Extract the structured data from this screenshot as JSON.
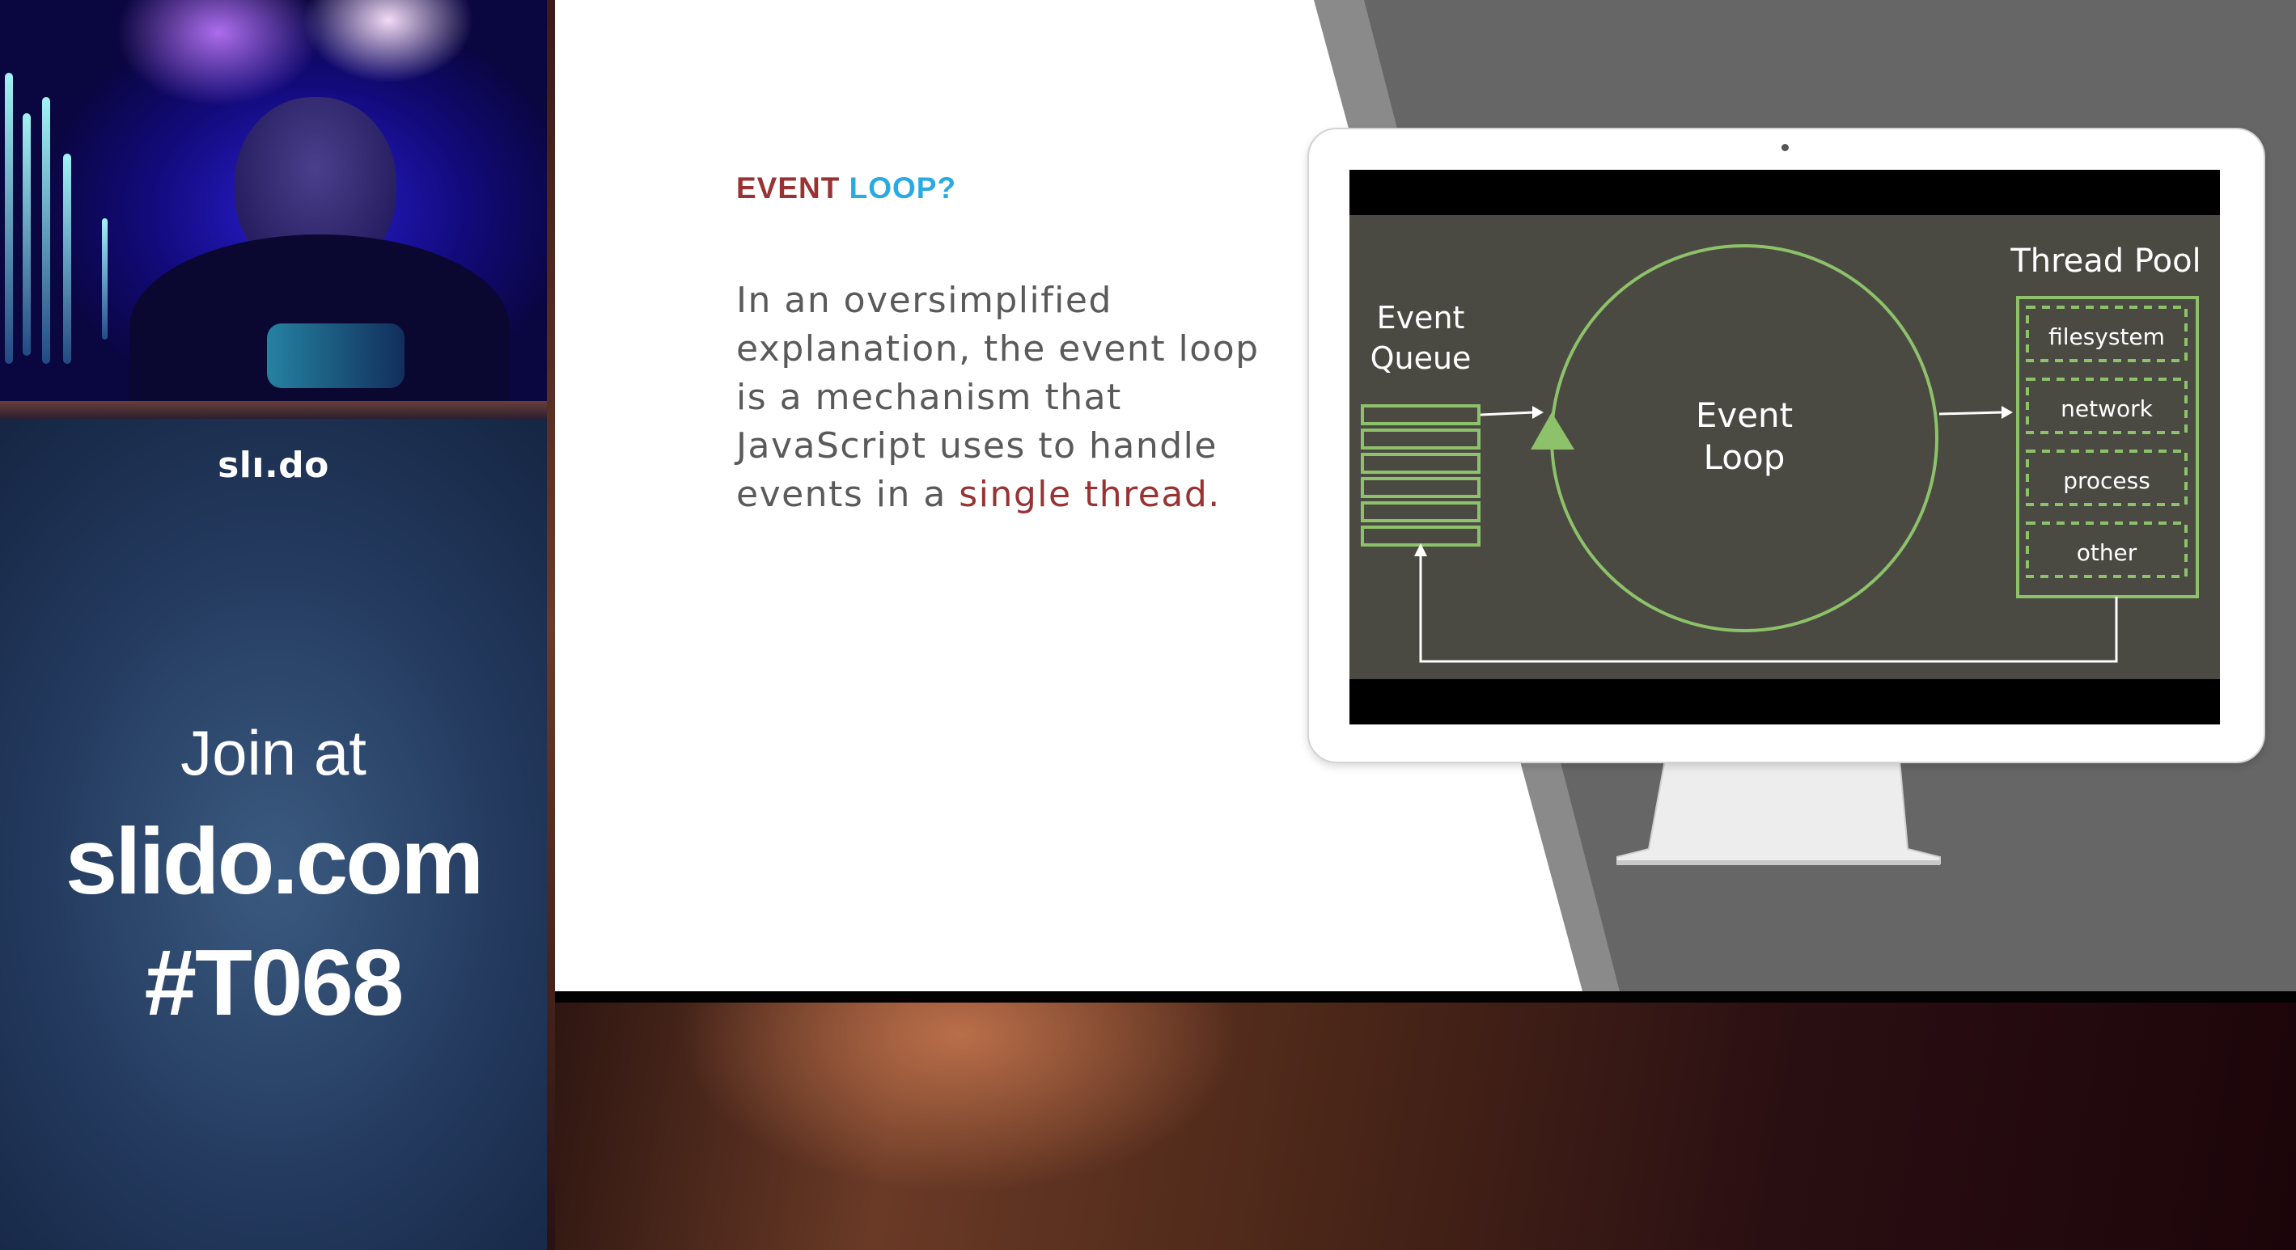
{
  "sidebar": {
    "logo_text": "slı.do",
    "join_text": "Join at",
    "url_text": "slido.com",
    "event_code": "#T068"
  },
  "slide": {
    "heading_part1": "EVENT",
    "heading_part2": "LOOP?",
    "body_text": "In an oversimplified explanation, the event loop is a mechanism that JavaScript uses to handle events in a",
    "body_highlight": "single thread."
  },
  "diagram": {
    "queue_label_line1": "Event",
    "queue_label_line2": "Queue",
    "loop_label_line1": "Event",
    "loop_label_line2": "Loop",
    "pool_title": "Thread Pool",
    "pool_items": [
      "filesystem",
      "network",
      "process",
      "other"
    ]
  },
  "colors": {
    "heading_red": "#993333",
    "heading_blue": "#29abe2",
    "diagram_green": "#8dc26a",
    "diagram_bg": "#4a4a42",
    "slide_gray": "#666666"
  }
}
